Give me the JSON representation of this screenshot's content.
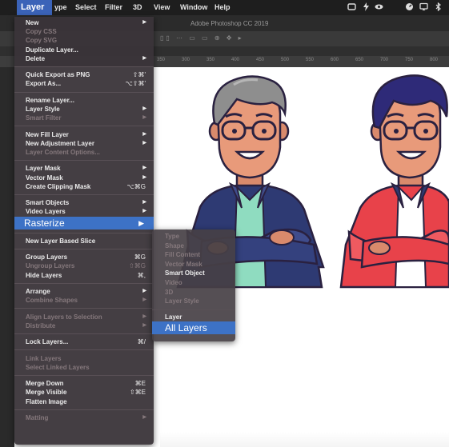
{
  "menubar": {
    "active": "Layer",
    "items": [
      {
        "label": "ype"
      },
      {
        "label": "Select"
      },
      {
        "label": "Filter"
      },
      {
        "label": "3D"
      },
      {
        "label": "View"
      },
      {
        "label": "Window"
      },
      {
        "label": "Help"
      }
    ]
  },
  "window": {
    "title": "Adobe Photoshop CC 2019"
  },
  "ruler": [
    "350",
    "300",
    "350",
    "400",
    "450",
    "500",
    "550",
    "600",
    "650",
    "700",
    "750",
    "800"
  ],
  "layer_menu": [
    {
      "label": "New",
      "arrow": true
    },
    {
      "label": "Copy CSS",
      "disabled": true
    },
    {
      "label": "Copy SVG",
      "disabled": true
    },
    {
      "label": "Duplicate Layer..."
    },
    {
      "label": "Delete",
      "arrow": true
    },
    {
      "sep": true
    },
    {
      "label": "Quick Export as PNG",
      "shortcut": "⇧⌘'"
    },
    {
      "label": "Export As...",
      "shortcut": "⌥⇧⌘'"
    },
    {
      "sep": true
    },
    {
      "label": "Rename Layer..."
    },
    {
      "label": "Layer Style",
      "arrow": true
    },
    {
      "label": "Smart Filter",
      "disabled": true,
      "arrow": true
    },
    {
      "sep": true
    },
    {
      "label": "New Fill Layer",
      "arrow": true
    },
    {
      "label": "New Adjustment Layer",
      "arrow": true
    },
    {
      "label": "Layer Content Options...",
      "disabled": true
    },
    {
      "sep": true
    },
    {
      "label": "Layer Mask",
      "arrow": true
    },
    {
      "label": "Vector Mask",
      "arrow": true
    },
    {
      "label": "Create Clipping Mask",
      "shortcut": "⌥⌘G"
    },
    {
      "sep": true
    },
    {
      "label": "Smart Objects",
      "arrow": true
    },
    {
      "label": "Video Layers",
      "arrow": true
    },
    {
      "label": "Rasterize",
      "arrow": true,
      "highlighted": true
    },
    {
      "sep": true
    },
    {
      "label": "New Layer Based Slice"
    },
    {
      "sep": true
    },
    {
      "label": "Group Layers",
      "shortcut": "⌘G"
    },
    {
      "label": "Ungroup Layers",
      "disabled": true,
      "shortcut": "⇧⌘G"
    },
    {
      "label": "Hide Layers",
      "shortcut": "⌘,"
    },
    {
      "sep": true
    },
    {
      "label": "Arrange",
      "arrow": true
    },
    {
      "label": "Combine Shapes",
      "disabled": true,
      "arrow": true
    },
    {
      "sep": true
    },
    {
      "label": "Align Layers to Selection",
      "disabled": true,
      "arrow": true
    },
    {
      "label": "Distribute",
      "disabled": true,
      "arrow": true
    },
    {
      "sep": true
    },
    {
      "label": "Lock Layers...",
      "shortcut": "⌘/"
    },
    {
      "sep": true
    },
    {
      "label": "Link Layers",
      "disabled": true
    },
    {
      "label": "Select Linked Layers",
      "disabled": true
    },
    {
      "sep": true
    },
    {
      "label": "Merge Down",
      "shortcut": "⌘E"
    },
    {
      "label": "Merge Visible",
      "shortcut": "⇧⌘E"
    },
    {
      "label": "Flatten Image"
    },
    {
      "sep": true
    },
    {
      "label": "Matting",
      "disabled": true,
      "arrow": true
    }
  ],
  "rasterize_menu": [
    {
      "label": "Type",
      "disabled": true
    },
    {
      "label": "Shape",
      "disabled": true
    },
    {
      "label": "Fill Content",
      "disabled": true
    },
    {
      "label": "Vector Mask",
      "disabled": true
    },
    {
      "label": "Smart Object"
    },
    {
      "label": "Video",
      "disabled": true
    },
    {
      "label": "3D",
      "disabled": true
    },
    {
      "label": "Layer Style",
      "disabled": true
    },
    {
      "sep": true
    },
    {
      "label": "Layer"
    },
    {
      "label": "All Layers",
      "highlighted": true
    }
  ],
  "colors": {
    "highlight": "#3d72c6",
    "menubar_active": "#3b63b8",
    "shirt_left": "#2e3a73",
    "shirt_right": "#e8424a",
    "teal_tee": "#8fdcc0"
  }
}
